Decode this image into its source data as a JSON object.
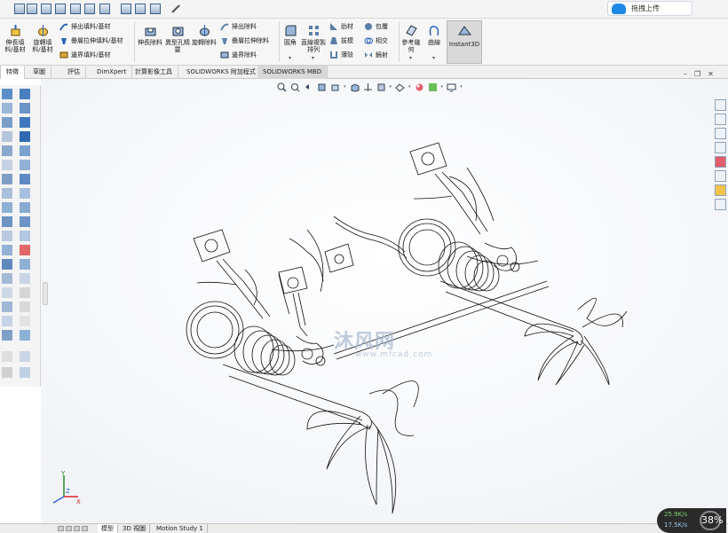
{
  "quick_access": {
    "icons": [
      "new-icon",
      "open-icon",
      "save-icon",
      "print-icon",
      "undo-icon",
      "redo-icon",
      "select-icon",
      "rebuild-icon",
      "options-icon"
    ],
    "upload_button_label": "拖拽上传"
  },
  "ribbon": {
    "extrude_boss_label": "伸長填料/基材",
    "revolve_boss_label": "旋轉填料/基材",
    "swept_boss_label": "掃出填料/基材",
    "loft_boss_label": "疊層拉伸填料/基材",
    "boundary_boss_label": "邊界填料/基材",
    "extrude_cut_label": "伸長除料",
    "hole_wizard_label": "異型孔精靈",
    "revolve_cut_label": "旋轉除料",
    "swept_cut_label": "掃出除料",
    "loft_cut_label": "疊層拉伸除料",
    "boundary_cut_label": "邊界除料",
    "fillet_label": "圓角",
    "linear_pattern_label": "直線複製排列",
    "rib_label": "肋材",
    "draft_label": "拔模",
    "shell_label": "薄殼",
    "wrap_label": "包覆",
    "intersect_label": "相交",
    "mirror_label": "鏡射",
    "reference_geometry_label": "參考幾何",
    "curves_label": "曲線",
    "instant3d_label": "Instant3D"
  },
  "tabs": [
    {
      "label": "特徵"
    },
    {
      "label": "草圖"
    },
    {
      "label": "評估"
    },
    {
      "label": "DimXpert"
    },
    {
      "label": "計算影像工具"
    },
    {
      "label": "SOLIDWORKS 附加程式"
    },
    {
      "label": "SOLIDWORKS MBD"
    }
  ],
  "watermark": {
    "brand": "沐风网",
    "url": "www.mfcad.com"
  },
  "bottom_tabs": [
    {
      "label": "模型"
    },
    {
      "label": "3D 視圖"
    },
    {
      "label": "Motion Study 1"
    }
  ],
  "net_speed": {
    "up": "25.9K/s",
    "down": "17.5K/s",
    "percent": "38%"
  },
  "triad": {
    "x": "X",
    "y": "Y",
    "z": "Z"
  },
  "colors": {
    "accent": "#1e88e5",
    "toolbar_bg": "#f6f6f6",
    "wireframe": "#111111"
  }
}
